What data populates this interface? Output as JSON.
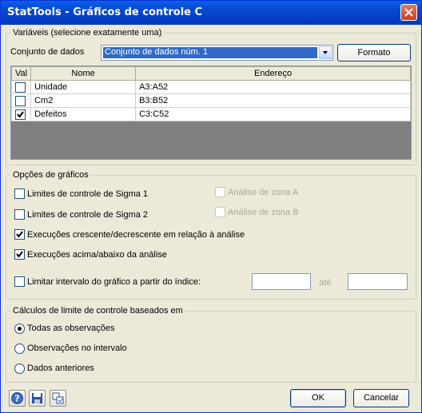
{
  "window": {
    "title": "StatTools - Gráficos de controle C"
  },
  "variables": {
    "legend": "Variáveis (selecione exatamente uma)",
    "dataset_label": "Conjunto de dados",
    "dataset_value": "Conjunto de dados núm. 1",
    "format_button": "Formato",
    "columns": [
      "Val",
      "Nome",
      "Endereço"
    ],
    "rows": [
      {
        "checked": false,
        "name": "Unidade",
        "address": "A3:A52"
      },
      {
        "checked": false,
        "name": "Cm2",
        "address": "B3:B52"
      },
      {
        "checked": true,
        "name": "Defeitos",
        "address": "C3:C52"
      }
    ]
  },
  "chart_options": {
    "legend": "Opções de gráficos",
    "sigma1": "Limites de controle de Sigma 1",
    "sigma2": "Limites de controle de Sigma 2",
    "zone_a": "Análise de zona A",
    "zone_b": "Análise de zona B",
    "runs_updown": "Execuções crescente/decrescente em relação à análise",
    "runs_abovebelow": "Execuções acima/abaixo da análise",
    "limit_range": "Limitar intervalo do gráfico a partir do índice:",
    "to_label": "até",
    "from_value": "",
    "to_value": ""
  },
  "limits": {
    "legend": "Cálculos de limite de controle baseados em",
    "all_obs": "Todas as observações",
    "obs_range": "Observações no intervalo",
    "prev_data": "Dados anteriores",
    "selected": "all_obs"
  },
  "footer": {
    "ok": "OK",
    "cancel": "Cancelar"
  },
  "icons": {
    "help": "help-icon",
    "save": "save-icon",
    "settings": "settings-icon"
  }
}
